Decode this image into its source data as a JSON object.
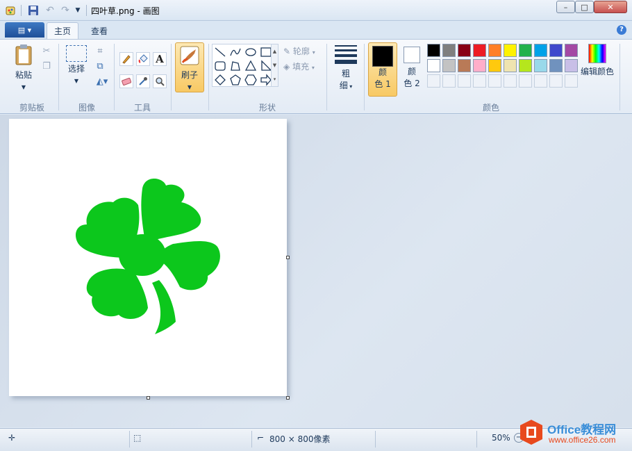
{
  "window": {
    "title": "四叶草.png - 画图",
    "minimize": "–",
    "maximize": "□",
    "close": "✕"
  },
  "tabs": [
    {
      "label": "主页"
    },
    {
      "label": "查看"
    }
  ],
  "help": "?",
  "clipboard": {
    "paste_label": "粘贴",
    "group": "剪贴板"
  },
  "image": {
    "select_label": "选择",
    "group": "图像"
  },
  "tools": {
    "group": "工具",
    "text_glyph": "A"
  },
  "brush": {
    "label": "刷子"
  },
  "shapes": {
    "outline_label": "轮廓",
    "fill_label": "填充",
    "group": "形状"
  },
  "size": {
    "line1": "粗",
    "line2": "细"
  },
  "colors": {
    "color1_line1": "颜",
    "color1_line2": "色 1",
    "color2_line1": "颜",
    "color2_line2": "色 2",
    "edit_label": "编辑颜色",
    "group": "颜色",
    "palette_row1": [
      "#000000",
      "#7f7f7f",
      "#880015",
      "#ed1c24",
      "#ff7f27",
      "#fff200",
      "#22b14c",
      "#00a2e8",
      "#3f48cc",
      "#a349a4"
    ],
    "palette_row2": [
      "#ffffff",
      "#c3c3c3",
      "#b97a57",
      "#ffaec9",
      "#ffc90e",
      "#efe4b0",
      "#b5e61d",
      "#99d9ea",
      "#7092be",
      "#c8bfe7"
    ],
    "clover_color": "#0cc71c"
  },
  "status": {
    "dimensions": "800 × 800像素",
    "zoom": "50%"
  },
  "watermark": {
    "brand": "Office教程网",
    "url": "www.office26.com"
  }
}
